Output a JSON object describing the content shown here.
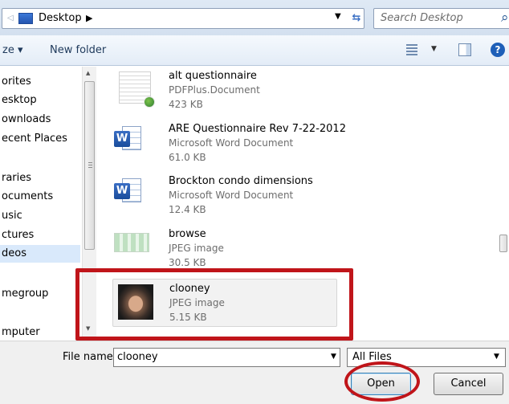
{
  "address_bar": {
    "location": "Desktop",
    "search_placeholder": "Search Desktop"
  },
  "toolbar": {
    "organize_label": "ze ▾",
    "new_folder_label": "New folder"
  },
  "nav": {
    "items": [
      {
        "label": "orites",
        "selected": false
      },
      {
        "label": "esktop",
        "selected": false
      },
      {
        "label": "ownloads",
        "selected": false
      },
      {
        "label": "ecent Places",
        "selected": false
      },
      {
        "label": "raries",
        "selected": false
      },
      {
        "label": "ocuments",
        "selected": false
      },
      {
        "label": "usic",
        "selected": false
      },
      {
        "label": "ctures",
        "selected": false
      },
      {
        "label": "deos",
        "selected": true
      },
      {
        "label": "megroup",
        "selected": false
      },
      {
        "label": "mputer",
        "selected": false
      }
    ]
  },
  "files": [
    {
      "name": "alt questionnaire",
      "type": "PDFPlus.Document",
      "size": "423 KB",
      "icon": "pdf-document-icon"
    },
    {
      "name": "ARE Questionnaire Rev 7-22-2012",
      "type": "Microsoft Word Document",
      "size": "61.0 KB",
      "icon": "word-document-icon"
    },
    {
      "name": "Brockton condo dimensions",
      "type": "Microsoft Word Document",
      "size": "12.4 KB",
      "icon": "word-document-icon"
    },
    {
      "name": "browse",
      "type": "JPEG image",
      "size": "30.5 KB",
      "icon": "jpeg-image-icon"
    },
    {
      "name": "clooney",
      "type": "JPEG image",
      "size": "5.15 KB",
      "icon": "portrait-photo-thumbnail"
    }
  ],
  "bottom": {
    "file_name_label": "File name:",
    "file_name_value": "clooney",
    "filter_value": "All Files",
    "open_label": "Open",
    "cancel_label": "Cancel"
  },
  "colors": {
    "annotation_red": "#c0151a",
    "selection_blue": "#d9e9fb"
  }
}
